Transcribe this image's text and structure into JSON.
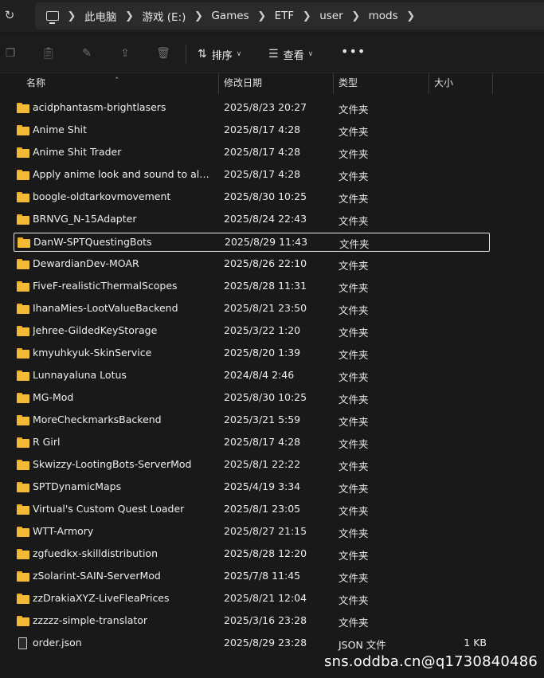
{
  "address": {
    "crumbs": [
      "此电脑",
      "游戏 (E:)",
      "Games",
      "ETF",
      "user",
      "mods"
    ]
  },
  "toolbar": {
    "sort_label": "排序",
    "view_label": "查看",
    "more_label": "•••"
  },
  "columns": {
    "name": "名称",
    "date": "修改日期",
    "type": "类型",
    "size": "大小"
  },
  "rows": [
    {
      "name": "acidphantasm-brightlasers",
      "date": "2025/8/23 20:27",
      "type": "文件夹",
      "size": ""
    },
    {
      "name": "Anime Shit",
      "date": "2025/8/17 4:28",
      "type": "文件夹",
      "size": ""
    },
    {
      "name": "Anime Shit Trader",
      "date": "2025/8/17 4:28",
      "type": "文件夹",
      "size": ""
    },
    {
      "name": "Apply anime look and sound to all c...",
      "date": "2025/8/17 4:28",
      "type": "文件夹",
      "size": ""
    },
    {
      "name": "boogle-oldtarkovmovement",
      "date": "2025/8/30 10:25",
      "type": "文件夹",
      "size": ""
    },
    {
      "name": "BRNVG_N-15Adapter",
      "date": "2025/8/24 22:43",
      "type": "文件夹",
      "size": ""
    },
    {
      "name": "DanW-SPTQuestingBots",
      "date": "2025/8/29 11:43",
      "type": "文件夹",
      "size": ""
    },
    {
      "name": "DewardianDev-MOAR",
      "date": "2025/8/26 22:10",
      "type": "文件夹",
      "size": ""
    },
    {
      "name": "FiveF-realisticThermalScopes",
      "date": "2025/8/28 11:31",
      "type": "文件夹",
      "size": ""
    },
    {
      "name": "IhanaMies-LootValueBackend",
      "date": "2025/8/21 23:50",
      "type": "文件夹",
      "size": ""
    },
    {
      "name": "Jehree-GildedKeyStorage",
      "date": "2025/3/22 1:20",
      "type": "文件夹",
      "size": ""
    },
    {
      "name": "kmyuhkyuk-SkinService",
      "date": "2025/8/20 1:39",
      "type": "文件夹",
      "size": ""
    },
    {
      "name": "Lunnayaluna Lotus",
      "date": "2024/8/4 2:46",
      "type": "文件夹",
      "size": ""
    },
    {
      "name": "MG-Mod",
      "date": "2025/8/30 10:25",
      "type": "文件夹",
      "size": ""
    },
    {
      "name": "MoreCheckmarksBackend",
      "date": "2025/3/21 5:59",
      "type": "文件夹",
      "size": ""
    },
    {
      "name": "R Girl",
      "date": "2025/8/17 4:28",
      "type": "文件夹",
      "size": ""
    },
    {
      "name": "Skwizzy-LootingBots-ServerMod",
      "date": "2025/8/1 22:22",
      "type": "文件夹",
      "size": ""
    },
    {
      "name": "SPTDynamicMaps",
      "date": "2025/4/19 3:34",
      "type": "文件夹",
      "size": ""
    },
    {
      "name": "Virtual's Custom Quest Loader",
      "date": "2025/8/1 23:05",
      "type": "文件夹",
      "size": ""
    },
    {
      "name": "WTT-Armory",
      "date": "2025/8/27 21:15",
      "type": "文件夹",
      "size": ""
    },
    {
      "name": "zgfuedkx-skilldistribution",
      "date": "2025/8/28 12:20",
      "type": "文件夹",
      "size": ""
    },
    {
      "name": "zSolarint-SAIN-ServerMod",
      "date": "2025/7/8 11:45",
      "type": "文件夹",
      "size": ""
    },
    {
      "name": "zzDrakiaXYZ-LiveFleaPrices",
      "date": "2025/8/21 12:04",
      "type": "文件夹",
      "size": ""
    },
    {
      "name": "zzzzz-simple-translator",
      "date": "2025/3/16 23:28",
      "type": "文件夹",
      "size": ""
    },
    {
      "name": "order.json",
      "date": "2025/8/29 23:28",
      "type": "JSON 文件",
      "size": "1 KB"
    }
  ],
  "watermark": "sns.oddba.cn@q1730840486",
  "colors": {
    "background": "#191919",
    "folder": "#f3bb34",
    "text": "#ededed"
  }
}
